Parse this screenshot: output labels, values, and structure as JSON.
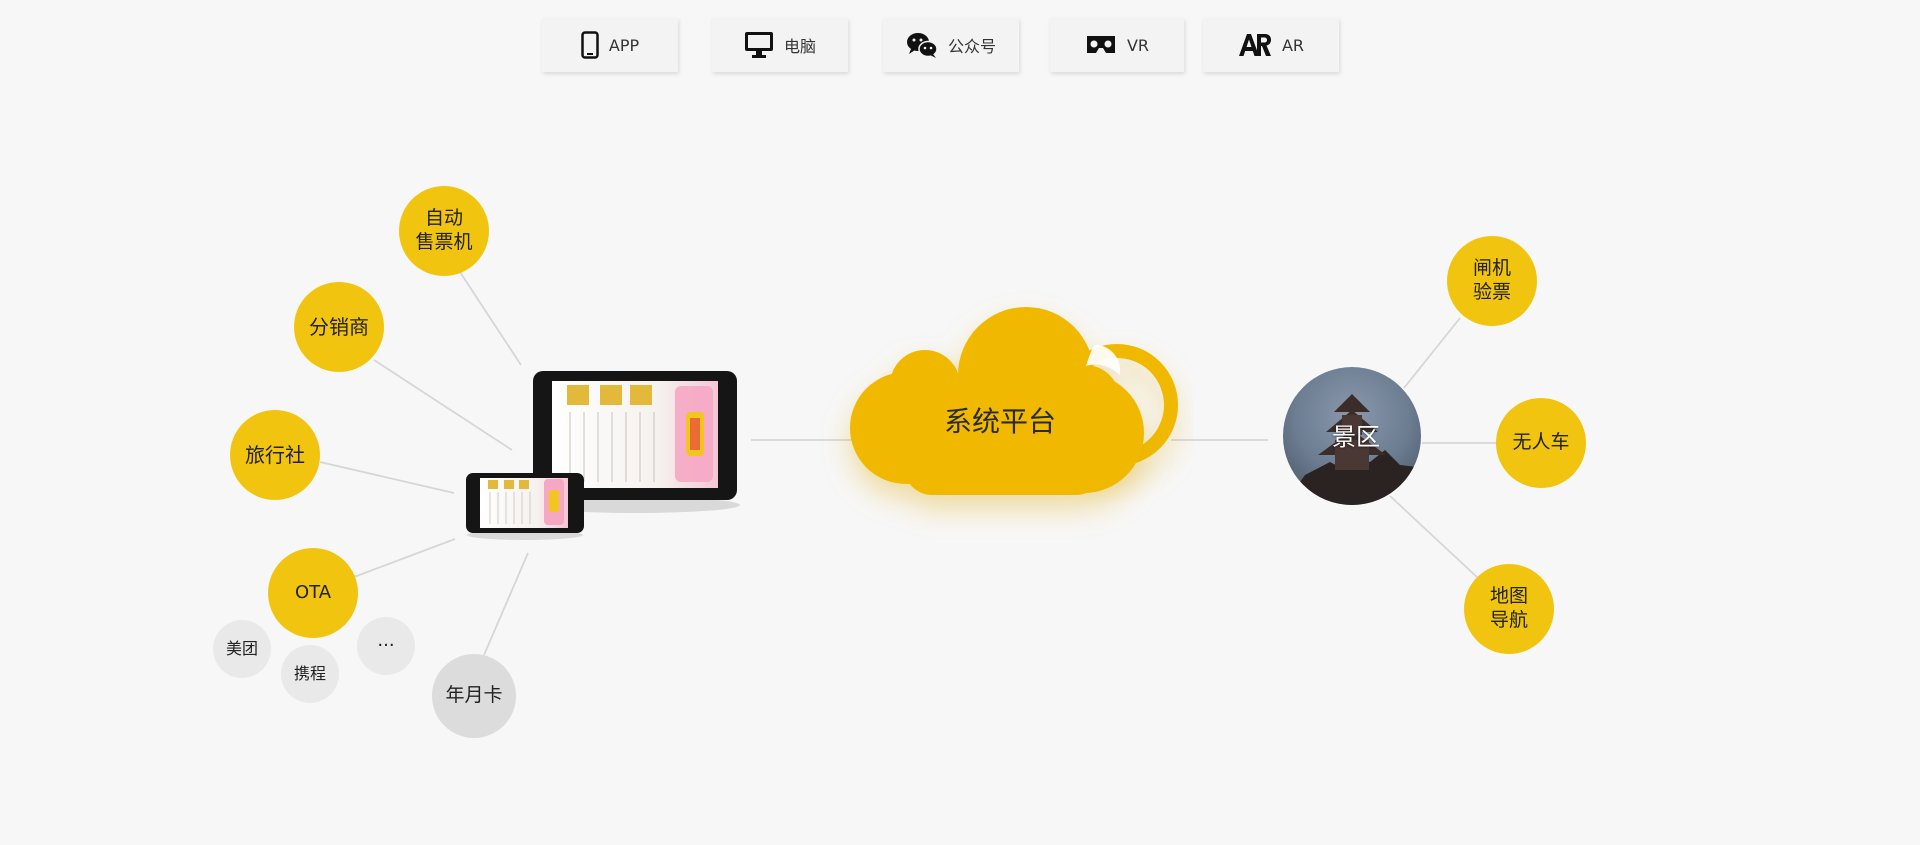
{
  "tabs": [
    {
      "label": "APP",
      "icon": "phone-icon"
    },
    {
      "label": "电脑",
      "icon": "monitor-icon"
    },
    {
      "label": "公众号",
      "icon": "wechat-icon"
    },
    {
      "label": "VR",
      "icon": "vr-headset-icon"
    },
    {
      "label": "AR",
      "icon": "ar-icon"
    }
  ],
  "diagram": {
    "center": "系统平台",
    "scenic": "景区",
    "left_nodes": {
      "vending": "自动\n售票机",
      "distributor": "分销商",
      "travel_agency": "旅行社",
      "ota": "OTA",
      "annual_card": "年月卡"
    },
    "ota_children": {
      "meituan": "美团",
      "ctrip": "携程",
      "more": "···"
    },
    "right_nodes": {
      "gate": "闸机\n验票",
      "driverless": "无人车",
      "map_nav": "地图\n导航"
    }
  },
  "colors": {
    "accent": "#f1c40f",
    "cloud": "#f0b905",
    "background": "#f7f7f7",
    "connector": "#d6d6d6"
  }
}
